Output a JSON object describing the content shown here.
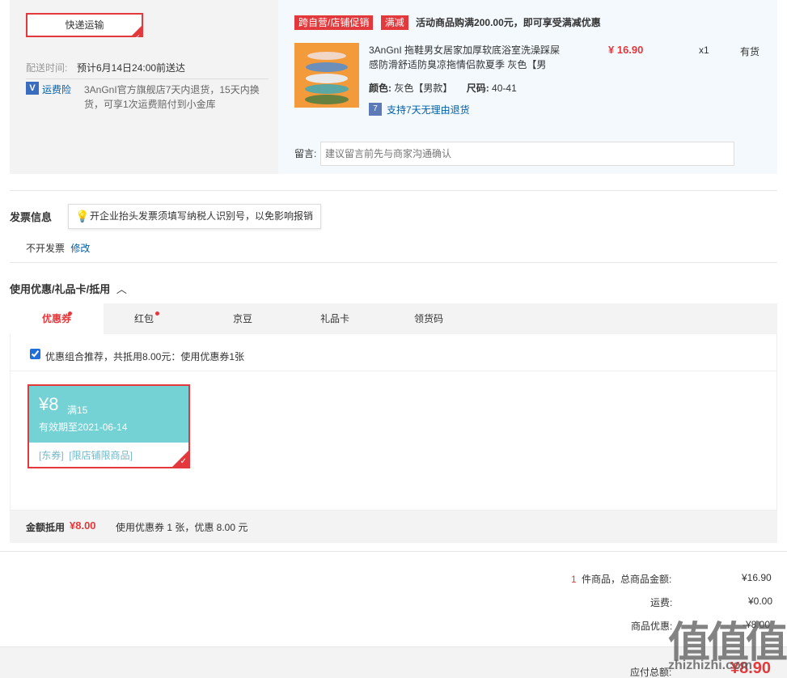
{
  "shipping": {
    "method_label": "快递运输",
    "delivery_label": "配送时间:",
    "delivery_value": "预计6月14日24:00前送达",
    "insurance_label": "运费险",
    "insurance_text_1": "3AnGnI官方旗舰店7天内退货，15天内换",
    "insurance_text_2": "货，可享1次运费赔付到小金库"
  },
  "promo": {
    "tag1": "跨自营/店铺促销",
    "tag2": "满减",
    "text": "活动商品购满200.00元，即可享受满减优惠"
  },
  "product": {
    "title_line1": "3AnGnI 拖鞋男女居家加厚软底浴室洗澡踩屎",
    "title_line2": "感防滑舒适防臭凉拖情侣款夏季 灰色【男",
    "price": "¥ 16.90",
    "qty": "x1",
    "stock": "有货",
    "color_label": "颜色:",
    "color_value": "灰色【男款】",
    "size_label": "尺码:",
    "size_value": "40-41",
    "return_text": "支持7天无理由退货"
  },
  "message": {
    "label": "留言:",
    "placeholder": "建议留言前先与商家沟通确认"
  },
  "invoice": {
    "heading": "发票信息",
    "tip": "开企业抬头发票须填写纳税人识别号，以免影响报销",
    "status": "不开发票",
    "modify": "修改"
  },
  "discount": {
    "heading": "使用优惠/礼品卡/抵用",
    "tabs": [
      "优惠券",
      "红包",
      "京豆",
      "礼品卡",
      "领货码"
    ],
    "recommend_text": "优惠组合推荐，共抵用8.00元：使用优惠券1张",
    "coupon": {
      "amount": "¥8",
      "threshold": "满15",
      "expiry": "有效期至2021-06-14",
      "tags": "[东券]  [限店铺限商品]"
    },
    "deduct_label": "金额抵用",
    "deduct_amount": "¥8.00",
    "deduct_desc": "使用优惠券 1 张，优惠 8.00 元"
  },
  "summary": {
    "count": "1",
    "count_suffix": "件商品，总商品金额:",
    "goods_total": "¥16.90",
    "freight_label": "运费:",
    "freight_value": "¥0.00",
    "discount_label": "商品优惠:",
    "discount_value": "-¥8.00",
    "payable_label": "应付总额:",
    "payable_value": "¥8.90"
  },
  "watermark": {
    "text": "值值值",
    "sub": "zhizhizhi.com"
  },
  "colors": {
    "accent": "#e4393c",
    "link": "#005ea7",
    "coupon": "#74d2d5"
  }
}
